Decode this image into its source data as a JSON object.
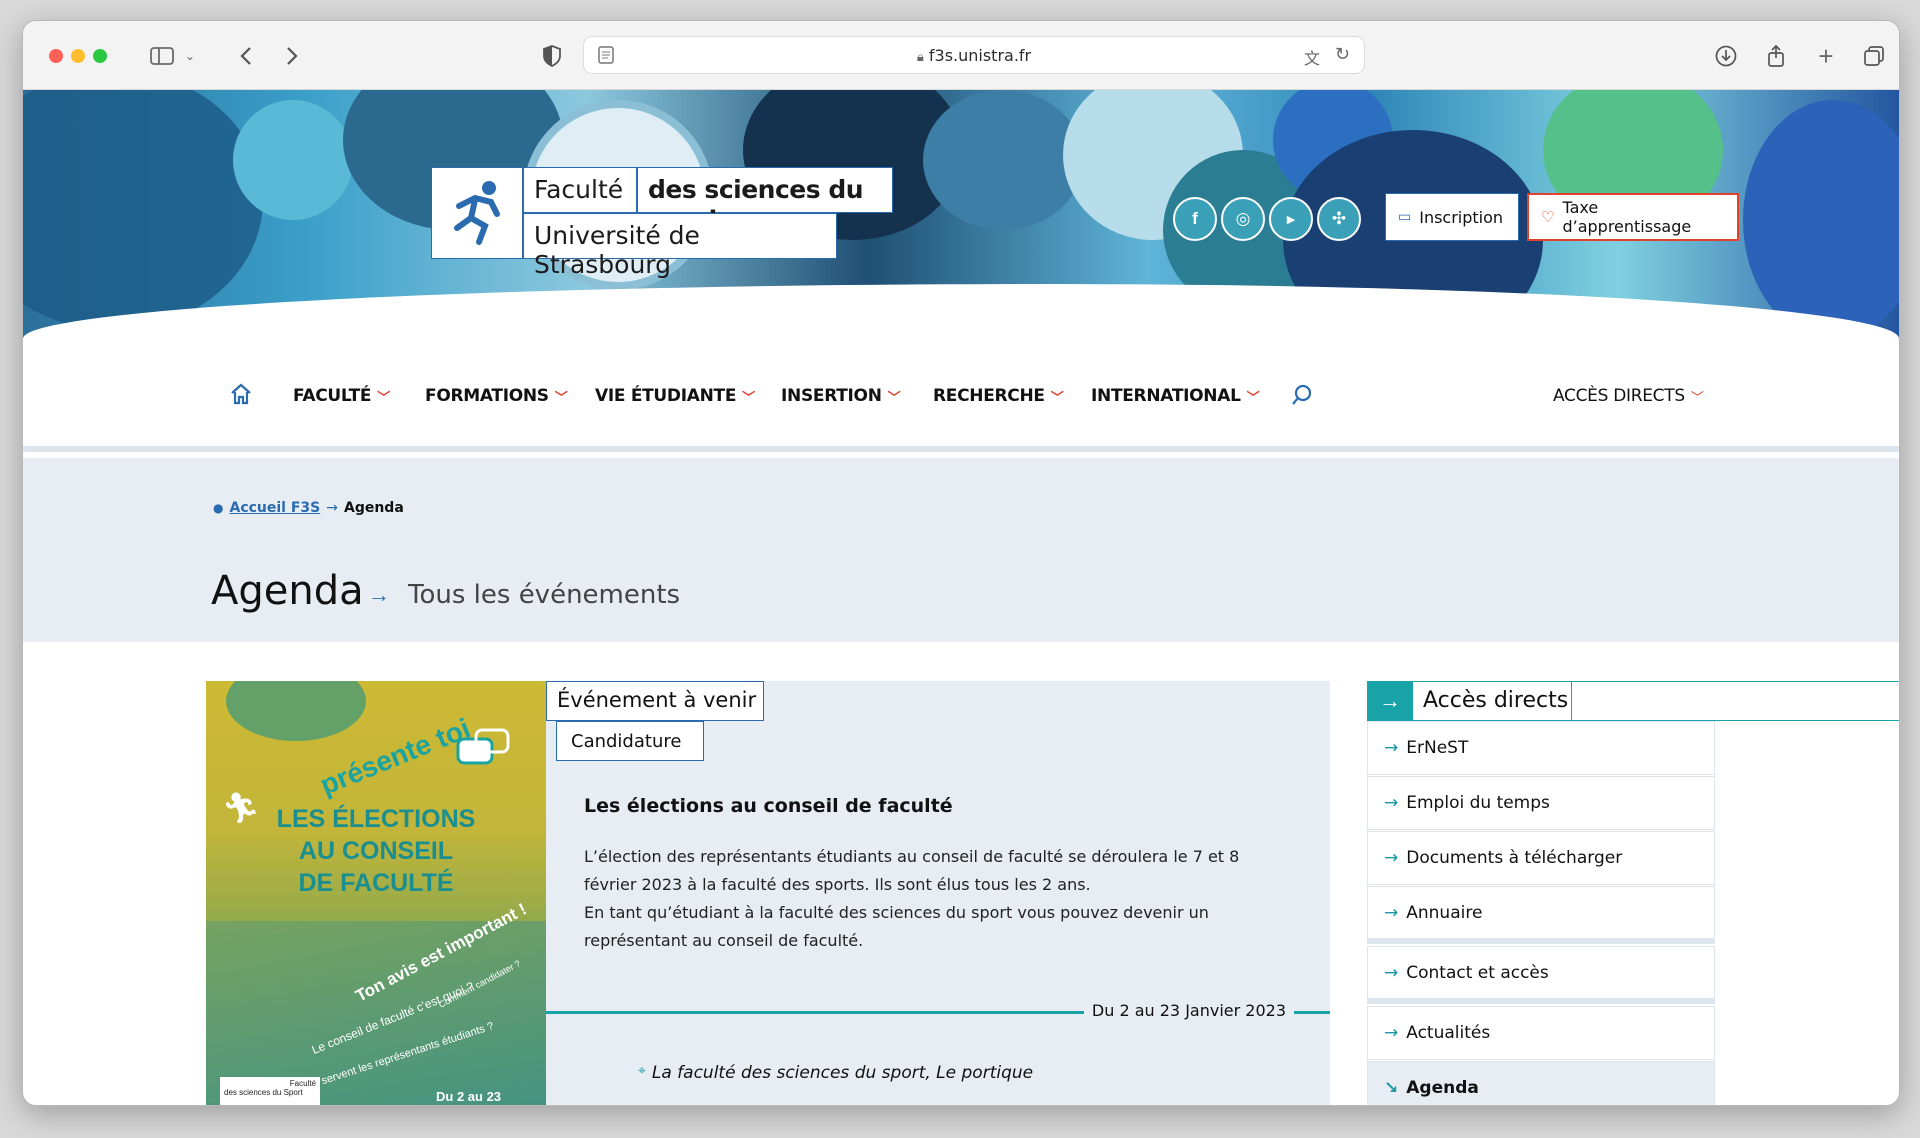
{
  "browser": {
    "url": "f3s.unistra.fr"
  },
  "header": {
    "logo_line1_a": "Faculté",
    "logo_line1_b": "des sciences du sport",
    "logo_line2": "Université de Strasbourg",
    "social": [
      {
        "icon": "facebook-icon",
        "glyph": "f"
      },
      {
        "icon": "instagram-icon",
        "glyph": "◎"
      },
      {
        "icon": "youtube-icon",
        "glyph": "▶"
      },
      {
        "icon": "network-icon",
        "glyph": "✣"
      }
    ],
    "inscription_label": "Inscription",
    "taxe_label": "Taxe d’apprentissage"
  },
  "nav": {
    "items": [
      "FACULTÉ",
      "FORMATIONS",
      "VIE ÉTUDIANTE",
      "INSERTION",
      "RECHERCHE",
      "INTERNATIONAL"
    ],
    "acces_directs": "ACCÈS DIRECTS"
  },
  "breadcrumb": {
    "home": "Accueil F3S",
    "current": "Agenda"
  },
  "page": {
    "title": "Agenda",
    "subtitle": "Tous les événements"
  },
  "event": {
    "status_tag": "Événement à venir",
    "category_tag": "Candidature",
    "title": "Les élections au conseil de faculté",
    "description_1": "L’élection des représentants étudiants au conseil de faculté se déroulera le 7 et 8 février 2023 à la faculté des sports. Ils sont élus tous les 2 ans.",
    "description_2": "En tant qu’étudiant à la faculté des sciences du sport vous pouvez devenir un représentant au conseil de faculté.",
    "date": "Du 2 au 23 Janvier 2023",
    "location": "La faculté des sciences du sport, Le portique",
    "poster": {
      "presente": "présente toi",
      "title_1": "LES ÉLECTIONS",
      "title_2": "AU CONSEIL",
      "title_3": "DE FACULTÉ",
      "avis": "Ton avis est important !",
      "q1": "Comment candidater ?",
      "q2": "Le conseil de faculté c’est quoi ?",
      "q3": "À quoi servent les représentants étudiants ?",
      "footer_1": "Faculté",
      "footer_2": "des sciences du Sport",
      "date": "Du 2 au 23"
    }
  },
  "sidebar": {
    "title": "Accès directs",
    "items": [
      "ErNeST",
      "Emploi du temps",
      "Documents à télécharger",
      "Annuaire",
      "Contact et accès",
      "Actualités",
      "Agenda"
    ]
  },
  "colors": {
    "accent_teal": "#17a3a8",
    "brand_blue": "#2a6bb0",
    "red": "#e2412c"
  }
}
